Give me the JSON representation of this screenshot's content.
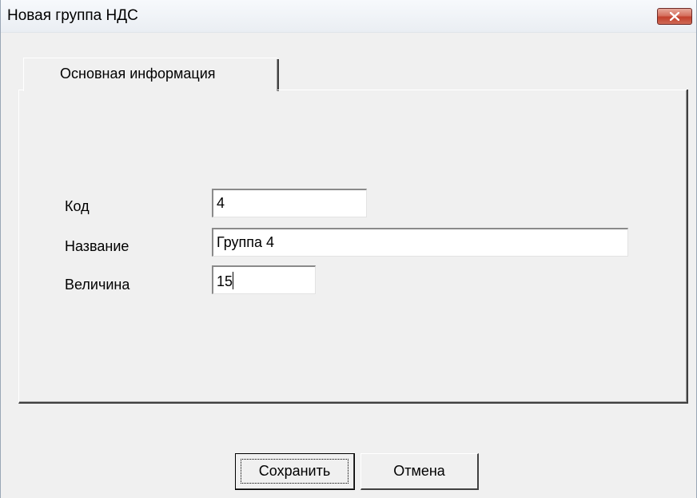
{
  "window": {
    "title": "Новая группа НДС",
    "close_icon": "close-x-icon"
  },
  "tabs": [
    {
      "label": "Основная информация",
      "selected": true
    }
  ],
  "form": {
    "code": {
      "label": "Код",
      "value": "4"
    },
    "name": {
      "label": "Название",
      "value": "Группа 4"
    },
    "amount": {
      "label": "Величина",
      "value": "15"
    }
  },
  "buttons": {
    "save_label": "Сохранить",
    "cancel_label": "Отмена"
  },
  "colors": {
    "close_button": "#c7503d",
    "dialog_background": "#f0f0f0"
  }
}
